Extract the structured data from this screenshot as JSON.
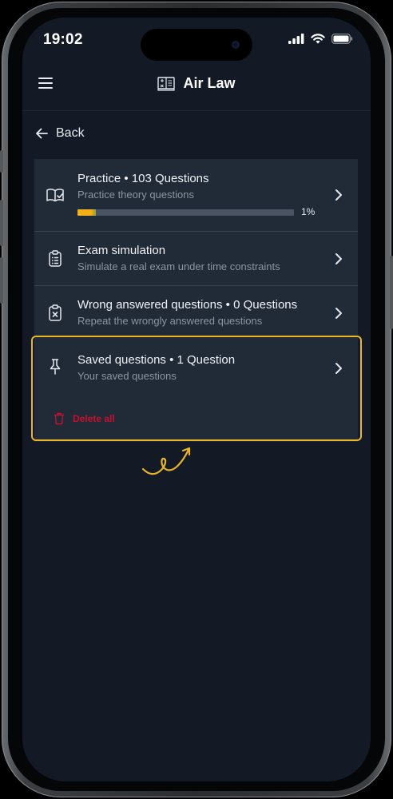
{
  "status_bar": {
    "time": "19:02",
    "icons": [
      "signal-icon",
      "wifi-icon",
      "battery-icon"
    ]
  },
  "header": {
    "menu_icon": "hamburger-menu-icon",
    "logo_icon": "book-logo-icon",
    "title": "Air Law"
  },
  "back": {
    "icon": "arrow-left-icon",
    "label": "Back"
  },
  "modes": [
    {
      "icon": "book-check-icon",
      "title": "Practice • 103 Questions",
      "subtitle": "Practice theory questions",
      "progress": 0.01,
      "progress_label": "1%"
    },
    {
      "icon": "clipboard-list-icon",
      "title": "Exam simulation",
      "subtitle": "Simulate a real exam under time constraints"
    },
    {
      "icon": "clipboard-x-icon",
      "title": "Wrong answered questions • 0 Questions",
      "subtitle": "Repeat the wrongly answered questions"
    },
    {
      "icon": "pin-icon",
      "title": "Saved questions • 1 Question",
      "subtitle": "Your saved questions",
      "delete_label": "Delete all",
      "delete_icon": "trash-icon"
    }
  ],
  "colors": {
    "screen_bg": "#131a26",
    "card_bg": "#212a37",
    "accent_yellow": "#e9b62a",
    "danger_red": "#c8102e",
    "subtitle_gray": "#8b95a3"
  }
}
